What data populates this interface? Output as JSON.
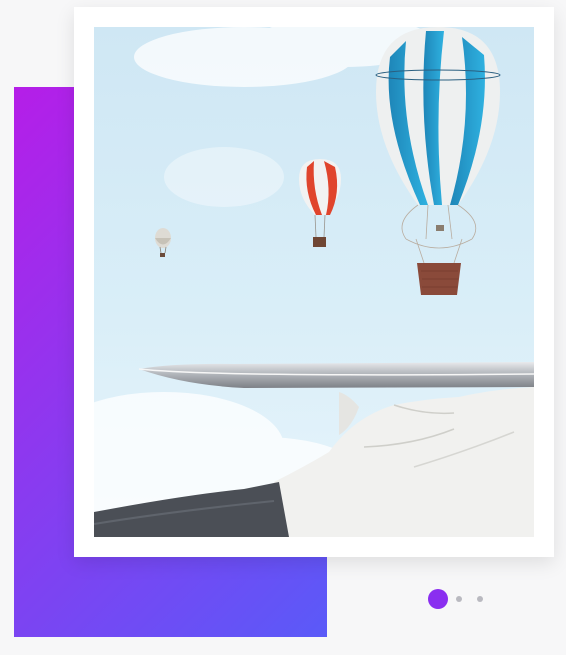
{
  "colors": {
    "gradient_start": "#b51ee8",
    "gradient_end": "#5a5af8",
    "dot_active": "#8a2ef0",
    "dot_inactive": "#b9b9c0",
    "background": "#f7f7f8"
  },
  "gallery": {
    "image_name": "hot-air-balloons-on-silver-tray",
    "slide_count": 3,
    "active_slide": 1
  }
}
